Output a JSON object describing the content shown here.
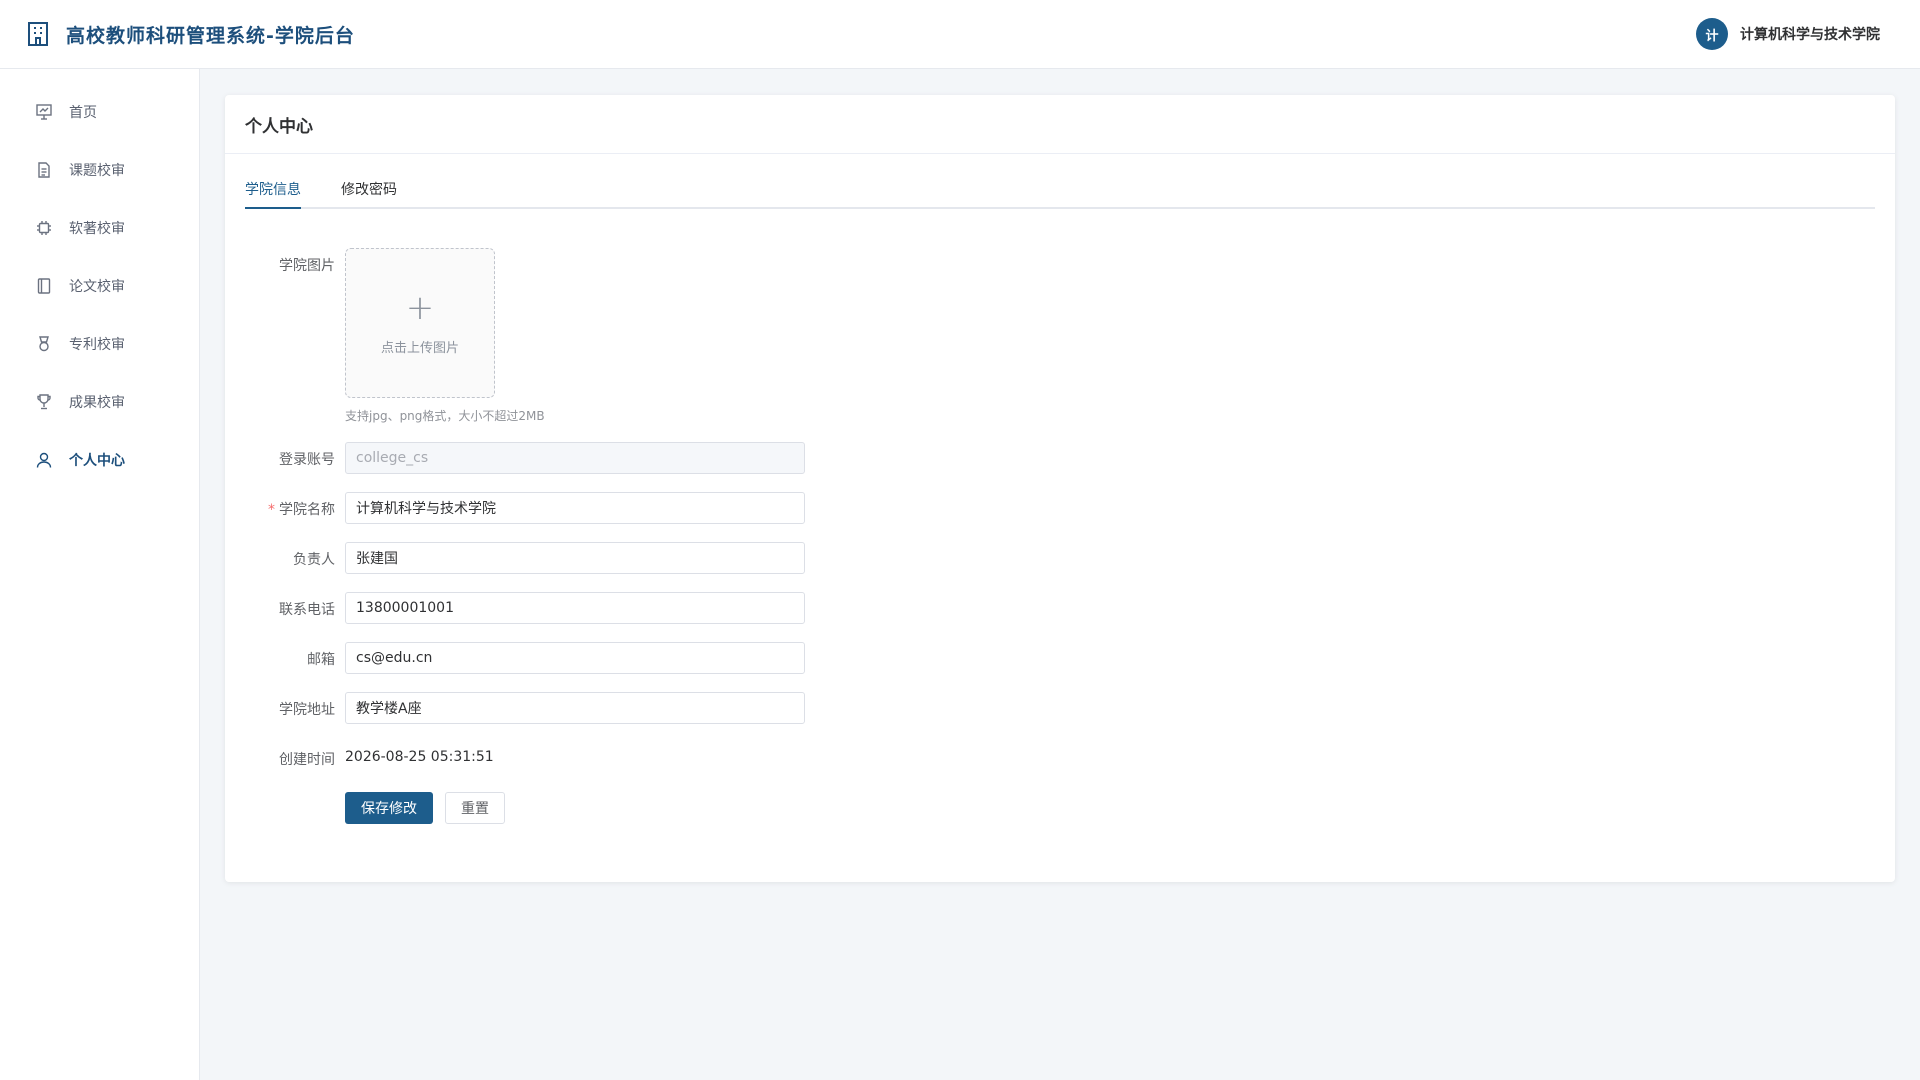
{
  "header": {
    "title": "高校教师科研管理系统-学院后台",
    "icon": "building-icon",
    "avatar_initial": "计",
    "user_name": "计算机科学与技术学院"
  },
  "sidebar": {
    "items": [
      {
        "label": "首页",
        "icon": "dashboard-icon",
        "active": false
      },
      {
        "label": "课题校审",
        "icon": "document-icon",
        "active": false
      },
      {
        "label": "软著校审",
        "icon": "chip-icon",
        "active": false
      },
      {
        "label": "论文校审",
        "icon": "notebook-icon",
        "active": false
      },
      {
        "label": "专利校审",
        "icon": "medal-icon",
        "active": false
      },
      {
        "label": "成果校审",
        "icon": "trophy-icon",
        "active": false
      },
      {
        "label": "个人中心",
        "icon": "user-icon",
        "active": true
      }
    ]
  },
  "card": {
    "title": "个人中心",
    "tabs": [
      {
        "label": "学院信息",
        "active": true
      },
      {
        "label": "修改密码",
        "active": false
      }
    ]
  },
  "form": {
    "image_label": "学院图片",
    "upload_text": "点击上传图片",
    "upload_hint": "支持jpg、png格式，大小不超过2MB",
    "account_label": "登录账号",
    "account_value": "college_cs",
    "name_label": "学院名称",
    "name_required_mark": "*",
    "name_value": "计算机科学与技术学院",
    "leader_label": "负责人",
    "leader_value": "张建国",
    "phone_label": "联系电话",
    "phone_value": "13800001001",
    "email_label": "邮箱",
    "email_value": "cs@edu.cn",
    "address_label": "学院地址",
    "address_value": "教学楼A座",
    "created_label": "创建时间",
    "created_value": "2026-08-25 05:31:51",
    "save_label": "保存修改",
    "reset_label": "重置"
  },
  "colors": {
    "primary": "#1d5d8c",
    "brand_text": "#1d4f7c",
    "required": "#f56c6c"
  }
}
